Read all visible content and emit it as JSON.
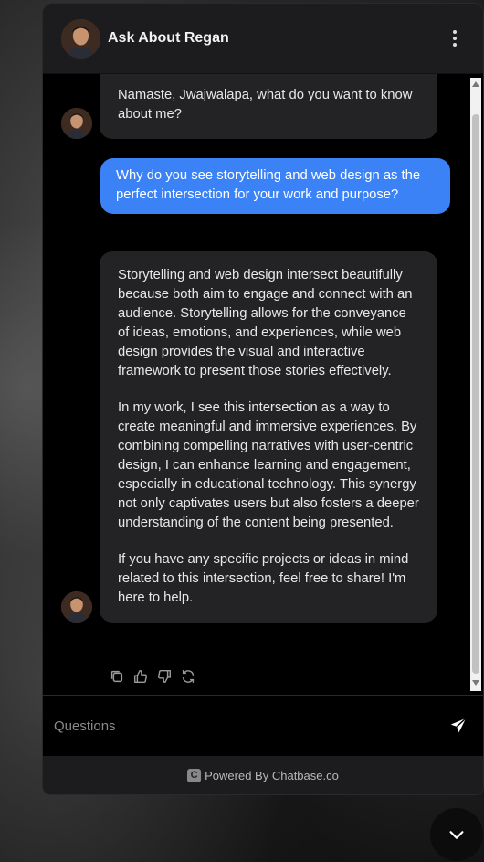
{
  "header": {
    "title": "Ask About Regan",
    "menu_icon": "kebab-menu-icon"
  },
  "messages": [
    {
      "role": "bot",
      "paragraphs": [
        "Namaste, Jwajwalapa, what do you want to know about me?"
      ]
    },
    {
      "role": "user",
      "text": "Why do you see storytelling and web design as the perfect intersection for your work and purpose?"
    },
    {
      "role": "bot",
      "paragraphs": [
        "Storytelling and web design intersect beautifully because both aim to engage and connect with an audience. Storytelling allows for the conveyance of ideas, emotions, and experiences, while web design provides the visual and interactive framework to present those stories effectively.",
        "In my work, I see this intersection as a way to create meaningful and immersive experiences. By combining compelling narratives with user-centric design, I can enhance learning and engagement, especially in educational technology. This synergy not only captivates users but also fosters a deeper understanding of the content being presented.",
        "If you have any specific projects or ideas in mind related to this intersection, feel free to share! I'm here to help."
      ]
    }
  ],
  "message_actions": [
    "copy-icon",
    "thumbs-up-icon",
    "thumbs-down-icon",
    "refresh-icon"
  ],
  "input": {
    "placeholder": "Questions",
    "value": ""
  },
  "footer": {
    "logo_letter": "C",
    "text": "Powered By Chatbase.co"
  },
  "colors": {
    "accent": "#3b82f6",
    "header_bg": "#1c1c1e",
    "bubble_bot": "#232325",
    "panel_bg": "#000000"
  }
}
